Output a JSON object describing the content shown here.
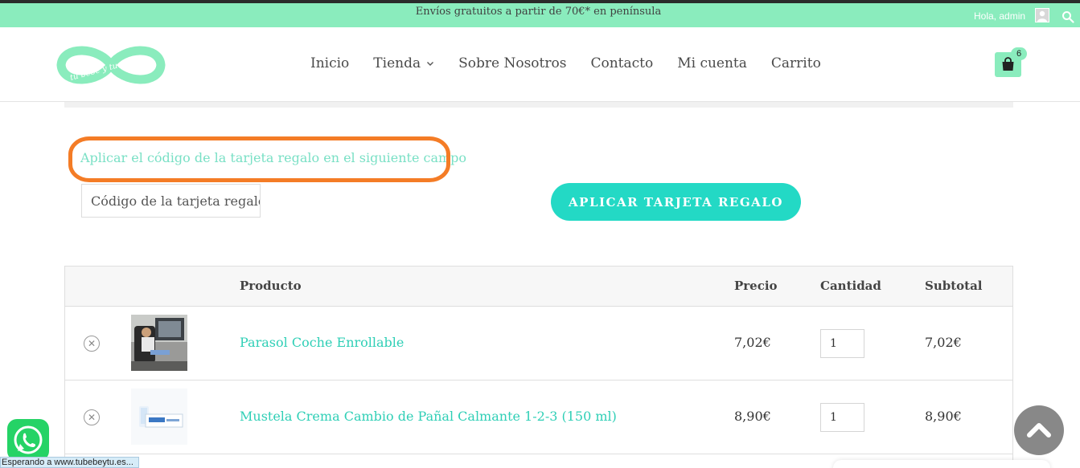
{
  "topbar": {
    "shipping_notice": "Envíos gratuitos a partir de 70€* en península",
    "greeting": "Hola, admin",
    "icons": [
      "user-avatar-icon",
      "search-icon"
    ]
  },
  "header": {
    "logo_text": "tu bebe y tu",
    "nav": [
      {
        "label": "Inicio"
      },
      {
        "label": "Tienda",
        "has_dropdown": true
      },
      {
        "label": "Sobre Nosotros"
      },
      {
        "label": "Contacto"
      },
      {
        "label": "Mi cuenta"
      },
      {
        "label": "Carrito"
      }
    ],
    "cart_count": "6",
    "cart_icon": "shopping-bag-icon"
  },
  "gift_card": {
    "label": "Aplicar el código de la tarjeta regalo en el siguiente campo",
    "input_placeholder": "Código de la tarjeta regalo",
    "apply_button": "APLICAR TARJETA REGALO"
  },
  "cart_table": {
    "headers": {
      "product": "Producto",
      "price": "Precio",
      "quantity": "Cantidad",
      "subtotal": "Subtotal"
    },
    "rows": [
      {
        "name": "Parasol Coche Enrollable",
        "price": "7,02€",
        "quantity": "1",
        "subtotal": "7,02€"
      },
      {
        "name": "Mustela Crema Cambio de Pañal Calmante 1-2-3 (150 ml)",
        "price": "8,90€",
        "quantity": "1",
        "subtotal": "8,90€"
      }
    ]
  },
  "status_bar": "Esperando a www.tubebeytu.es...",
  "colors": {
    "topbar": "#8aecbd",
    "accent": "#23d9c5",
    "link": "#2fcfb6",
    "highlight": "#f47c26",
    "scroll_button": "#888888",
    "whatsapp": "#25d366"
  }
}
